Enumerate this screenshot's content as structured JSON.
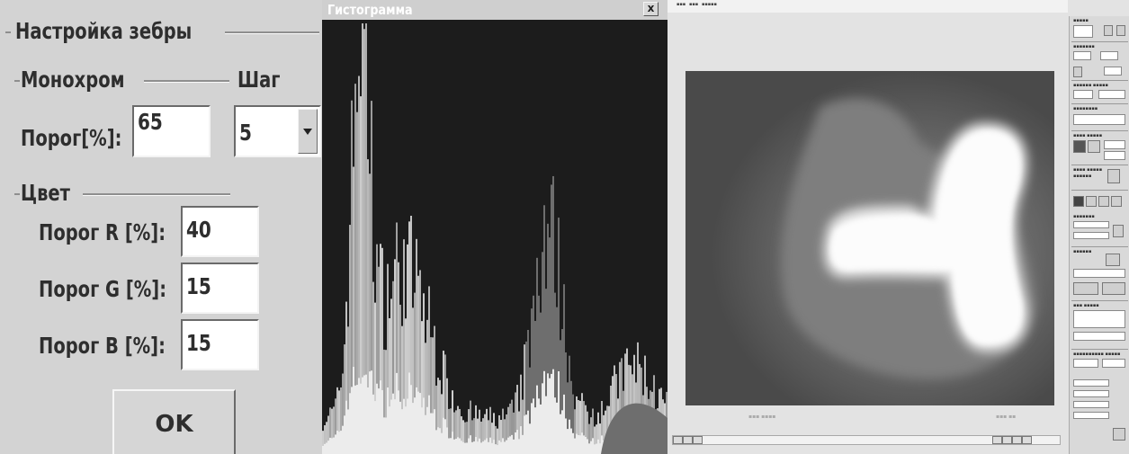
{
  "zebra": {
    "title": "Настройка зебры",
    "mono_label": "Монохром",
    "step_label": "Шаг",
    "threshold_label": "Порог[%]:",
    "threshold_value": "65",
    "step_value": "5",
    "color_label": "Цвет",
    "r_label": "Порог R [%]:",
    "r_value": "40",
    "g_label": "Порог G [%]:",
    "g_value": "15",
    "b_label": "Порог B [%]:",
    "b_value": "15",
    "ok_label": "OK"
  },
  "histogram": {
    "title": "Гистограмма",
    "close_label": "x"
  },
  "colors": {
    "dialog_bg": "#d3d3d3",
    "histogram_bg": "#1c1c1c",
    "image_bg": "#4c4c4c"
  }
}
